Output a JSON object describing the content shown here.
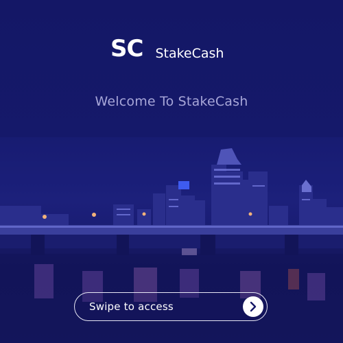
{
  "logo": {
    "mark": "SC",
    "name": "StakeCash"
  },
  "welcome": {
    "text": "Welcome To StakeCash"
  },
  "swipe": {
    "label": "Swipe to access",
    "icon": "chevron-right-icon"
  },
  "colors": {
    "background": "#141766",
    "welcome_text": "#a7a6d8",
    "swipe_border": "#e8e8f5",
    "knob": "#ffffff",
    "knob_icon": "#141766"
  },
  "background_image": {
    "icon": "city-skyline-night-icon"
  }
}
